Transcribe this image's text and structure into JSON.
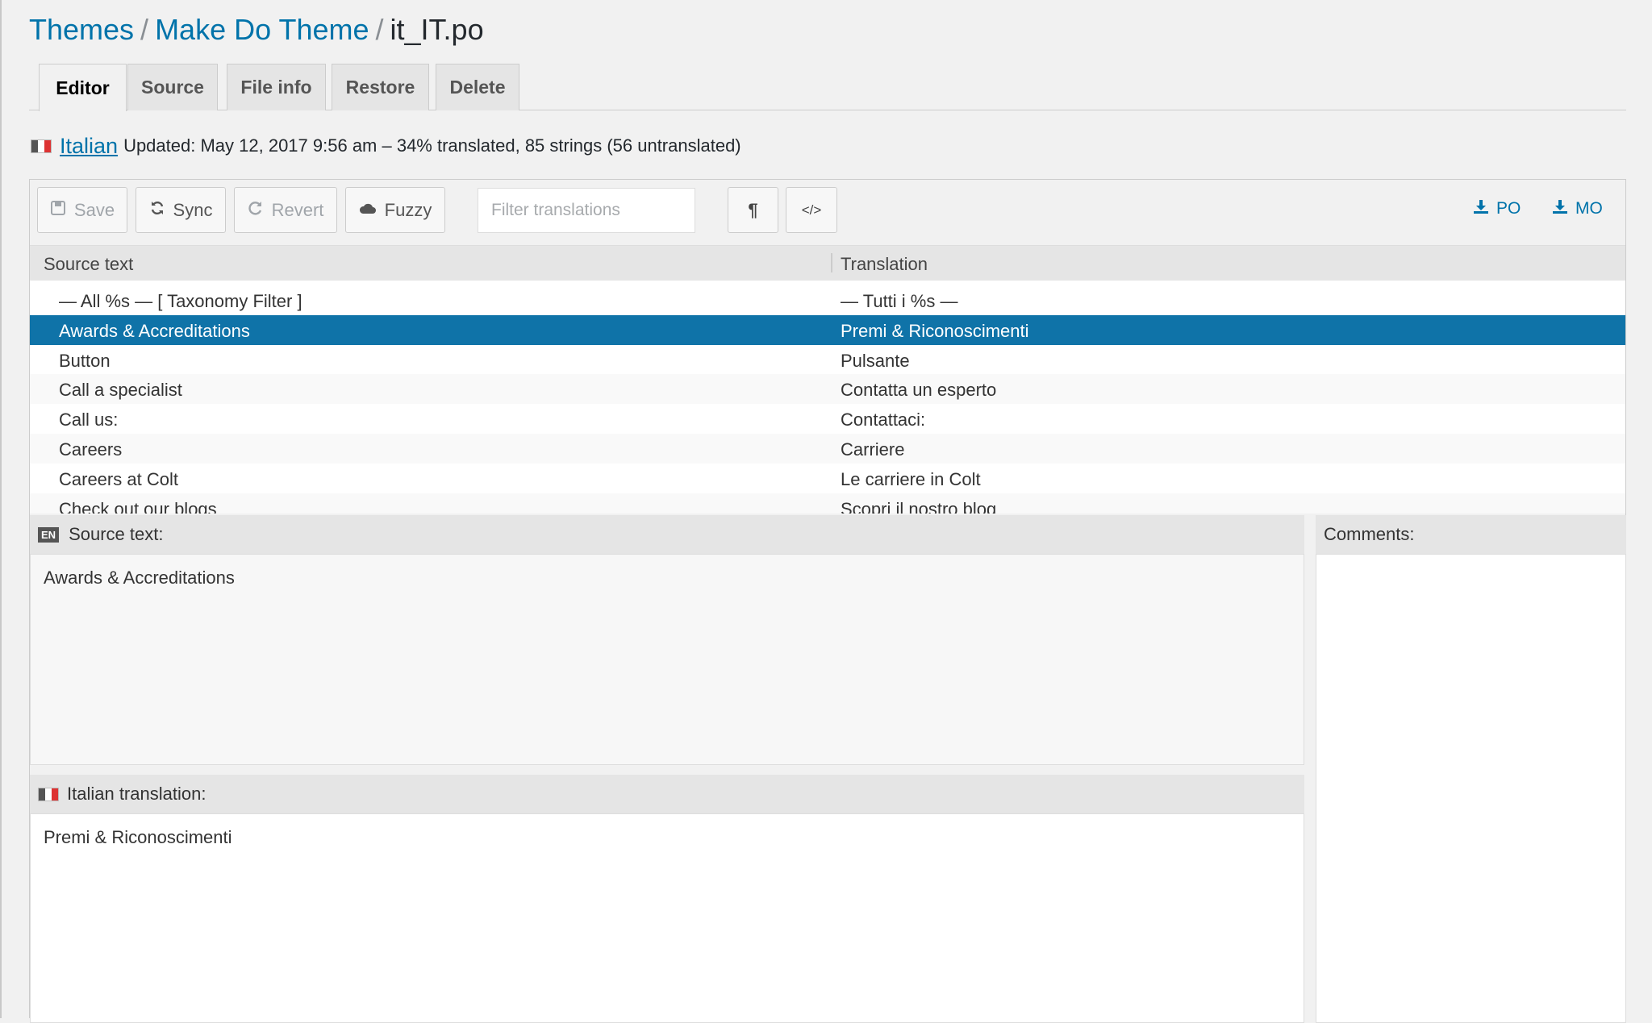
{
  "breadcrumb": {
    "items": [
      "Themes",
      "Make Do Theme"
    ],
    "separator": "/",
    "current": "it_IT.po"
  },
  "tabs": [
    {
      "label": "Editor",
      "active": true
    },
    {
      "label": "Source"
    },
    {
      "label": "File info"
    },
    {
      "label": "Restore"
    },
    {
      "label": "Delete"
    }
  ],
  "status": {
    "language": "Italian",
    "info": "Updated: May 12, 2017 9:56 am – 34% translated, 85 strings (56 untranslated)"
  },
  "toolbar": {
    "save": "Save",
    "sync": "Sync",
    "revert": "Revert",
    "fuzzy": "Fuzzy",
    "filter_placeholder": "Filter translations",
    "pilcrow": "¶",
    "code": "</>",
    "download_po": "PO",
    "download_mo": "MO"
  },
  "list": {
    "headers": {
      "source": "Source text",
      "translation": "Translation"
    },
    "selected_index": 1,
    "rows": [
      {
        "source": "— All %s — [ Taxonomy Filter ]",
        "translation": "— Tutti i %s —"
      },
      {
        "source": "Awards & Accreditations",
        "translation": "Premi & Riconoscimenti"
      },
      {
        "source": "Button",
        "translation": "Pulsante"
      },
      {
        "source": "Call a specialist",
        "translation": "Contatta un esperto"
      },
      {
        "source": "Call us:",
        "translation": "Contattaci:"
      },
      {
        "source": "Careers",
        "translation": "Carriere"
      },
      {
        "source": "Careers at Colt",
        "translation": "Le carriere in Colt"
      },
      {
        "source": "Check out our blogs",
        "translation": "Scopri il nostro blog"
      }
    ]
  },
  "source_pane": {
    "badge": "EN",
    "title": "Source text:",
    "text": "Awards & Accreditations"
  },
  "translation_pane": {
    "title": "Italian translation:",
    "text": "Premi & Riconoscimenti"
  },
  "comments_pane": {
    "title": "Comments:"
  },
  "colors": {
    "link": "#0073aa",
    "selected_row": "#0f73a8"
  }
}
